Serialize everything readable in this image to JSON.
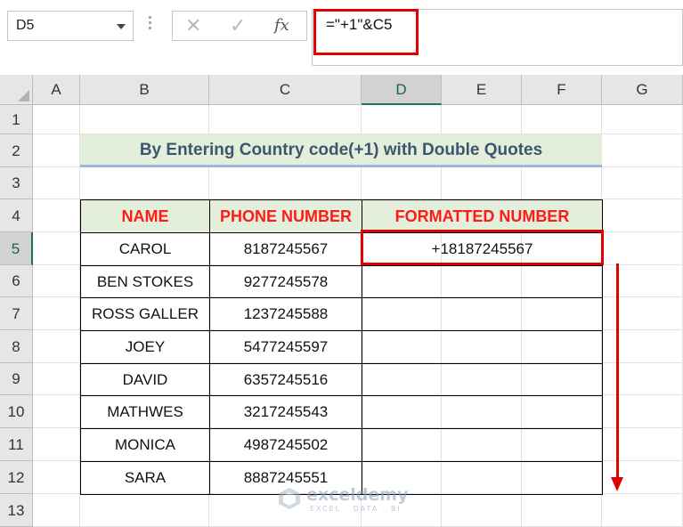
{
  "formula_bar": {
    "name_box": "D5",
    "cancel_glyph": "✕",
    "enter_glyph": "✓",
    "fx_label": "fx",
    "formula": "=\"+1\"&C5"
  },
  "columns": [
    "A",
    "B",
    "C",
    "D",
    "E",
    "F",
    "G"
  ],
  "rows": [
    "1",
    "2",
    "3",
    "4",
    "5",
    "6",
    "7",
    "8",
    "9",
    "10",
    "11",
    "12",
    "13"
  ],
  "selected_cell": {
    "column": "D",
    "row": "5"
  },
  "sheet": {
    "title": "By Entering Country code(+1) with Double Quotes",
    "headers": {
      "name": "NAME",
      "phone": "PHONE NUMBER",
      "formatted": "FORMATTED NUMBER"
    },
    "records": [
      {
        "name": "CAROL",
        "phone": "8187245567",
        "formatted": "+18187245567"
      },
      {
        "name": "BEN STOKES",
        "phone": "9277245578",
        "formatted": ""
      },
      {
        "name": "ROSS GALLER",
        "phone": "1237245588",
        "formatted": ""
      },
      {
        "name": "JOEY",
        "phone": "5477245597",
        "formatted": ""
      },
      {
        "name": "DAVID",
        "phone": "6357245516",
        "formatted": ""
      },
      {
        "name": "MATHWES",
        "phone": "3217245543",
        "formatted": ""
      },
      {
        "name": "MONICA",
        "phone": "4987245502",
        "formatted": ""
      },
      {
        "name": "SARA",
        "phone": "8887245551",
        "formatted": ""
      }
    ]
  },
  "watermark": {
    "name": "exceldemy",
    "tagline": "EXCEL · DATA · BI"
  },
  "colors": {
    "highlight_red": "#e00000",
    "header_text_red": "#ff1a1a",
    "title_fill": "#e3efda",
    "title_text": "#3d5670",
    "excel_green": "#217346"
  },
  "icons": {
    "name_box_dropdown": "chevron-down-icon",
    "cancel": "cancel-icon",
    "enter": "enter-icon",
    "insert_function": "fx-icon",
    "fill_direction": "arrow-down-icon",
    "watermark_logo": "exceldemy-logo-icon"
  }
}
